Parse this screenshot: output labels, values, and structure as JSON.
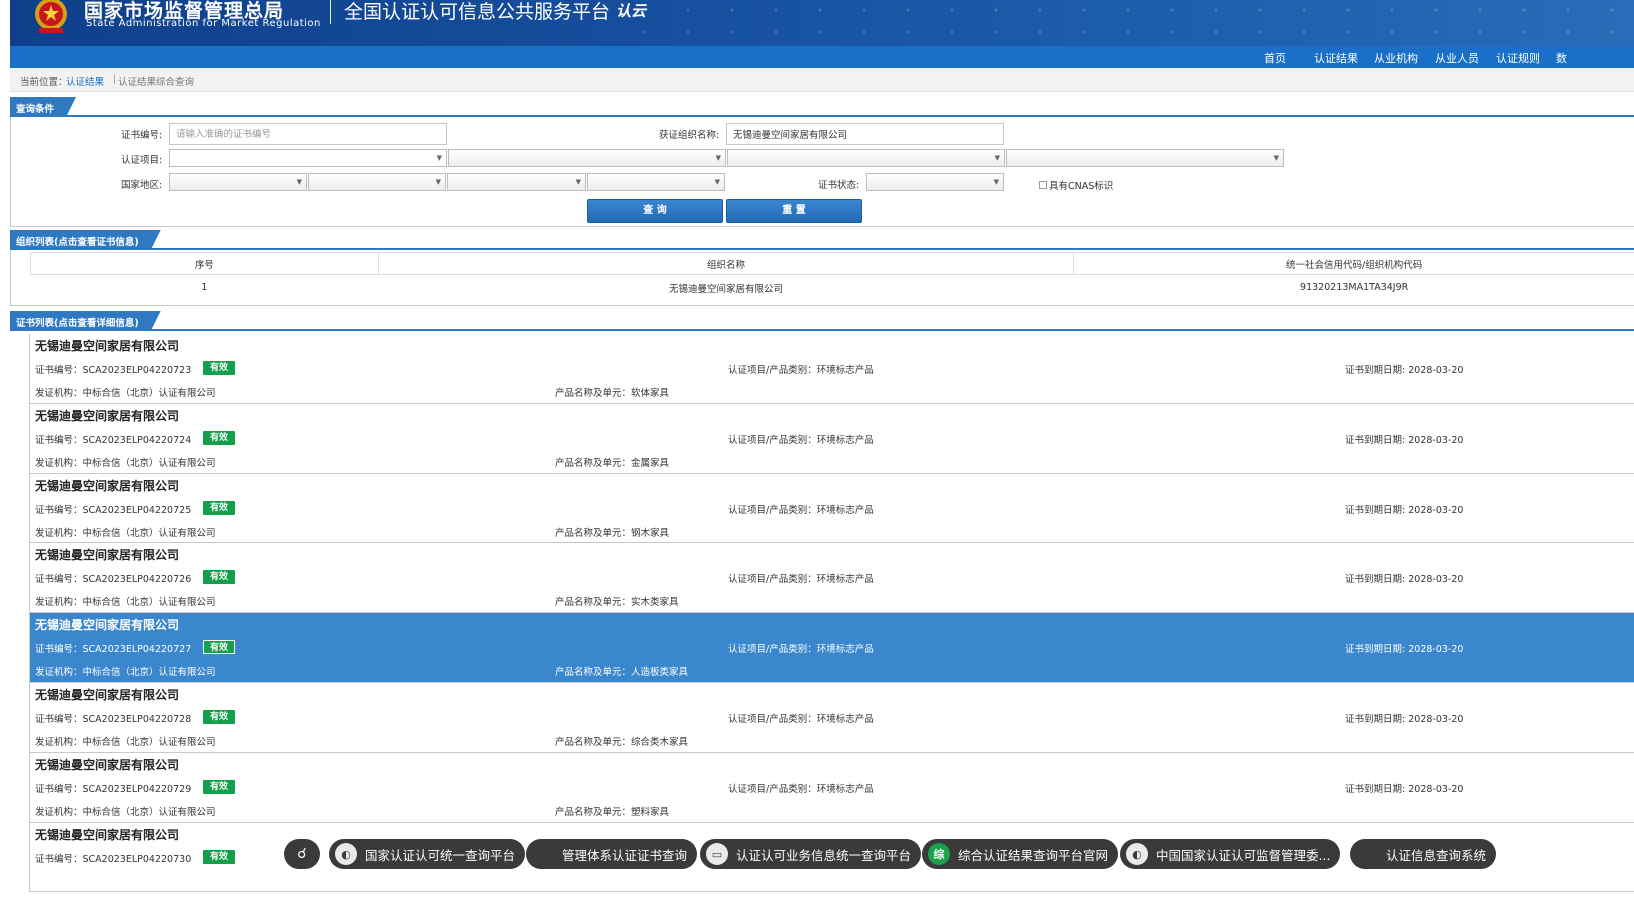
{
  "header": {
    "org_cn": "国家市场监督管理总局",
    "org_en": "State Administration  for  Market Regulation",
    "platform": "全国认证认可信息公共服务平台",
    "platform_logo": "认云"
  },
  "nav": [
    "首页",
    "认证结果",
    "从业机构",
    "从业人员",
    "认证规则",
    "数"
  ],
  "breadcrumb": {
    "label": "当前位置：",
    "link": "认证结果",
    "sep": "|",
    "current": "认证结果综合查询"
  },
  "query": {
    "section_title": "查询条件",
    "cert_no_label": "证书编号:",
    "cert_no_placeholder": "请输入准确的证书编号",
    "org_name_label": "获证组织名称:",
    "org_name_value": "无锡迪曼空间家居有限公司",
    "cert_item_label": "认证项目:",
    "region_label": "国家地区:",
    "cert_status_label": "证书状态:",
    "cnas_label": "具有CNAS标识",
    "search_button": "查 询",
    "reset_button": "重 置"
  },
  "org_list": {
    "section_title": "组织列表(点击查看证书信息)",
    "columns": [
      "序号",
      "组织名称",
      "统一社会信用代码/组织机构代码"
    ],
    "rows": [
      [
        "1",
        "无锡迪曼空间家居有限公司",
        "91320213MA1TA34J9R"
      ]
    ]
  },
  "cert_list": {
    "section_title": "证书列表(点击查看详细信息)",
    "labels": {
      "cert_no": "证书编号：",
      "item": "认证项目/产品类别：",
      "expiry": "证书到期日期: ",
      "issuer": "发证机构：",
      "product": "产品名称及单元："
    },
    "items": [
      {
        "org": "无锡迪曼空间家居有限公司",
        "cert_no": "SCA2023ELP04220723",
        "status": "有效",
        "item": "环境标志产品",
        "expiry": "2028-03-20",
        "issuer": "中标合信（北京）认证有限公司",
        "product": "软体家具"
      },
      {
        "org": "无锡迪曼空间家居有限公司",
        "cert_no": "SCA2023ELP04220724",
        "status": "有效",
        "item": "环境标志产品",
        "expiry": "2028-03-20",
        "issuer": "中标合信（北京）认证有限公司",
        "product": "金属家具"
      },
      {
        "org": "无锡迪曼空间家居有限公司",
        "cert_no": "SCA2023ELP04220725",
        "status": "有效",
        "item": "环境标志产品",
        "expiry": "2028-03-20",
        "issuer": "中标合信（北京）认证有限公司",
        "product": "钢木家具"
      },
      {
        "org": "无锡迪曼空间家居有限公司",
        "cert_no": "SCA2023ELP04220726",
        "status": "有效",
        "item": "环境标志产品",
        "expiry": "2028-03-20",
        "issuer": "中标合信（北京）认证有限公司",
        "product": "实木类家具"
      },
      {
        "org": "无锡迪曼空间家居有限公司",
        "cert_no": "SCA2023ELP04220727",
        "status": "有效",
        "item": "环境标志产品",
        "expiry": "2028-03-20",
        "issuer": "中标合信（北京）认证有限公司",
        "product": "人造板类家具",
        "selected": true
      },
      {
        "org": "无锡迪曼空间家居有限公司",
        "cert_no": "SCA2023ELP04220728",
        "status": "有效",
        "item": "环境标志产品",
        "expiry": "2028-03-20",
        "issuer": "中标合信（北京）认证有限公司",
        "product": "综合类木家具"
      },
      {
        "org": "无锡迪曼空间家居有限公司",
        "cert_no": "SCA2023ELP04220729",
        "status": "有效",
        "item": "环境标志产品",
        "expiry": "2028-03-20",
        "issuer": "中标合信（北京）认证有限公司",
        "product": "塑料家具"
      },
      {
        "org": "无锡迪曼空间家居有限公司",
        "cert_no": "SCA2023ELP04220730",
        "status": "有效",
        "item": "",
        "expiry": "",
        "issuer": "",
        "product": ""
      }
    ]
  },
  "link_bar": [
    {
      "label": "国家认证认可统一查询平台",
      "icon": "globe-icon"
    },
    {
      "label": "管理体系认证证书查询",
      "icon": "blank-icon"
    },
    {
      "label": "认证认可业务信息统一查询平台",
      "icon": "document-icon"
    },
    {
      "label": "综合认证结果查询平台官网",
      "icon": "green-seal-icon",
      "icon_text": "综"
    },
    {
      "label": "中国国家认证认可监督管理委...",
      "icon": "globe-icon"
    },
    {
      "label": "认证信息查询系统",
      "icon": "blank-icon"
    }
  ],
  "colors": {
    "header": "#164f9e",
    "nav": "#1a6fc9",
    "section": "#2f79c2",
    "selected_row": "#3b87cd",
    "badge": "#13a04a"
  }
}
